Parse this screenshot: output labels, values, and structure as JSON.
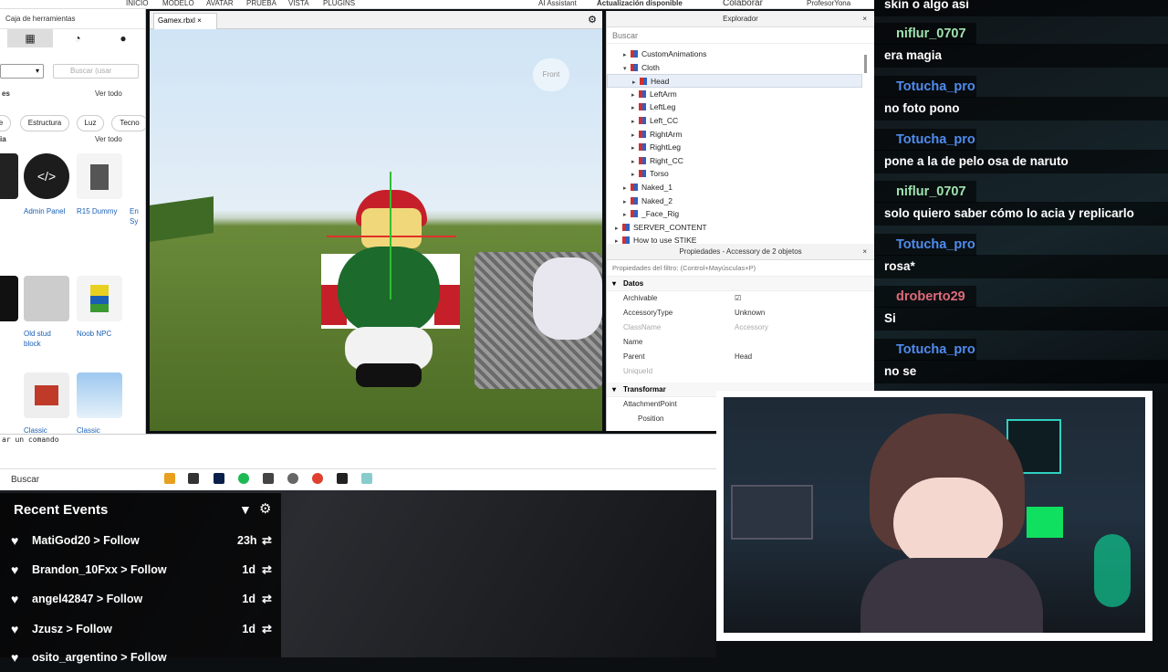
{
  "studio": {
    "menu": [
      "INICIO",
      "MODELO",
      "AVATAR",
      "PRUEBA",
      "VISTA",
      "PLUGINS"
    ],
    "ai_assistant": "AI Assistant",
    "update": "Actualización disponible",
    "collaborate": "Colaborar",
    "user": "ProfesorYona",
    "toolbox": {
      "title": "Caja de herramientas",
      "search_placeholder": "Buscar (usar",
      "ver_todo_1": "Ver todo",
      "ver_todo_2": "Ver todo",
      "chips": [
        "Estructura",
        "Luz",
        "Tecno"
      ],
      "tiles": [
        "Admin Panel",
        "R15 Dummy",
        "En Sy",
        "Old stud block",
        "Noob NPC",
        "Classic",
        "Classic"
      ]
    },
    "viewport_tab": "Gamex.rbxl",
    "front_label": "Front",
    "explorer": {
      "title": "Explorador",
      "search": "Buscar",
      "items": [
        {
          "label": "CustomAnimations",
          "indent": 2
        },
        {
          "label": "Cloth",
          "indent": 2
        },
        {
          "label": "Head",
          "indent": 3
        },
        {
          "label": "LeftArm",
          "indent": 3
        },
        {
          "label": "LeftLeg",
          "indent": 3
        },
        {
          "label": "Left_CC",
          "indent": 3
        },
        {
          "label": "RightArm",
          "indent": 3
        },
        {
          "label": "RightLeg",
          "indent": 3
        },
        {
          "label": "Right_CC",
          "indent": 3
        },
        {
          "label": "Torso",
          "indent": 3
        },
        {
          "label": "Naked_1",
          "indent": 2
        },
        {
          "label": "Naked_2",
          "indent": 2
        },
        {
          "label": "_Face_Rig",
          "indent": 2
        },
        {
          "label": "SERVER_CONTENT",
          "indent": 1
        },
        {
          "label": "How to use STIKE",
          "indent": 1
        }
      ]
    },
    "properties": {
      "title": "Propiedades - Accessory de 2 objetos",
      "filter": "Propiedades del filtro: (Control+Mayúsculas+P)",
      "section_data": "Datos",
      "rows": [
        {
          "k": "Archivable",
          "v": "☑"
        },
        {
          "k": "AccessoryType",
          "v": "Unknown"
        },
        {
          "k": "ClassName",
          "v": "Accessory"
        },
        {
          "k": "Name",
          "v": ""
        },
        {
          "k": "Parent",
          "v": "Head"
        },
        {
          "k": "UniqueId",
          "v": ""
        }
      ],
      "section_transform": "Transformar",
      "attachment": "AttachmentPoint",
      "position": "Position"
    },
    "command": "ar un comando",
    "taskbar_search": "Buscar"
  },
  "events": {
    "title": "Recent Events",
    "rows": [
      {
        "name": "MatiGod20 > Follow",
        "time": "23h"
      },
      {
        "name": "Brandon_10Fxx > Follow",
        "time": "1d"
      },
      {
        "name": "angel42847 > Follow",
        "time": "1d"
      },
      {
        "name": "Jzusz > Follow",
        "time": "1d"
      },
      {
        "name": "osito_argentino > Follow",
        "time": ""
      }
    ]
  },
  "chat": [
    {
      "type": "msg",
      "text": "skin o algo asi"
    },
    {
      "type": "name",
      "text": "niflur_0707",
      "color": "#9fe3b0"
    },
    {
      "type": "msg",
      "text": "era magia"
    },
    {
      "type": "name",
      "text": "Totucha_pro",
      "color": "#4f8cf0"
    },
    {
      "type": "msg",
      "text": "no foto pono"
    },
    {
      "type": "name",
      "text": "Totucha_pro",
      "color": "#4f8cf0"
    },
    {
      "type": "msg",
      "text": "pone a la de pelo osa de naruto"
    },
    {
      "type": "name",
      "text": "niflur_0707",
      "color": "#9fe3b0"
    },
    {
      "type": "msg",
      "text": "solo quiero saber cómo lo acia y replicarlo"
    },
    {
      "type": "name",
      "text": "Totucha_pro",
      "color": "#4f8cf0"
    },
    {
      "type": "msg",
      "text": "rosa*"
    },
    {
      "type": "name",
      "text": "droberto29",
      "color": "#e06a7a"
    },
    {
      "type": "msg",
      "text": "Si"
    },
    {
      "type": "name",
      "text": "Totucha_pro",
      "color": "#4f8cf0"
    },
    {
      "type": "msg",
      "text": "no se"
    }
  ]
}
